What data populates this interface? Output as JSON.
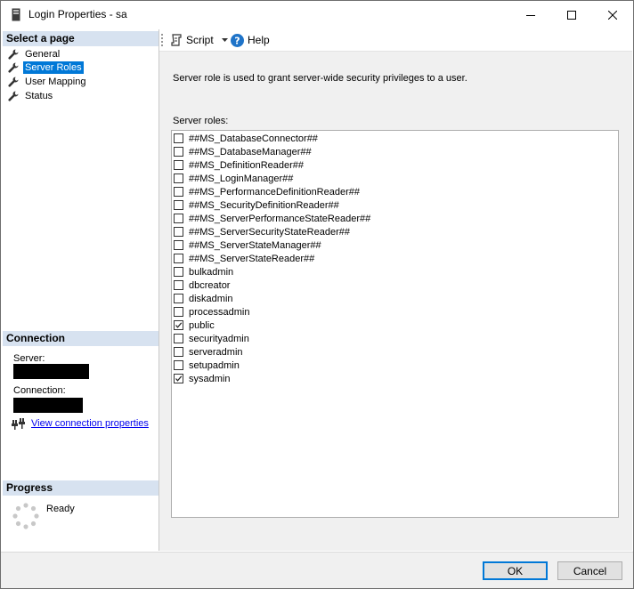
{
  "window": {
    "title": "Login Properties - sa"
  },
  "left": {
    "select_page_header": "Select a page",
    "pages": [
      {
        "label": "General",
        "selected": false
      },
      {
        "label": "Server Roles",
        "selected": true
      },
      {
        "label": "User Mapping",
        "selected": false
      },
      {
        "label": "Status",
        "selected": false
      }
    ],
    "connection_header": "Connection",
    "server_label": "Server:",
    "connection_label": "Connection:",
    "view_connection_properties": "View connection properties",
    "progress_header": "Progress",
    "progress_status": "Ready"
  },
  "toolbar": {
    "script_label": "Script",
    "help_label": "Help"
  },
  "main": {
    "description": "Server role is used to grant server-wide security privileges to a user.",
    "roles_label": "Server roles:",
    "roles": [
      {
        "name": "##MS_DatabaseConnector##",
        "checked": false
      },
      {
        "name": "##MS_DatabaseManager##",
        "checked": false
      },
      {
        "name": "##MS_DefinitionReader##",
        "checked": false
      },
      {
        "name": "##MS_LoginManager##",
        "checked": false
      },
      {
        "name": "##MS_PerformanceDefinitionReader##",
        "checked": false
      },
      {
        "name": "##MS_SecurityDefinitionReader##",
        "checked": false
      },
      {
        "name": "##MS_ServerPerformanceStateReader##",
        "checked": false
      },
      {
        "name": "##MS_ServerSecurityStateReader##",
        "checked": false
      },
      {
        "name": "##MS_ServerStateManager##",
        "checked": false
      },
      {
        "name": "##MS_ServerStateReader##",
        "checked": false
      },
      {
        "name": "bulkadmin",
        "checked": false
      },
      {
        "name": "dbcreator",
        "checked": false
      },
      {
        "name": "diskadmin",
        "checked": false
      },
      {
        "name": "processadmin",
        "checked": false
      },
      {
        "name": "public",
        "checked": true
      },
      {
        "name": "securityadmin",
        "checked": false
      },
      {
        "name": "serveradmin",
        "checked": false
      },
      {
        "name": "setupadmin",
        "checked": false
      },
      {
        "name": "sysadmin",
        "checked": true
      }
    ]
  },
  "footer": {
    "ok_label": "OK",
    "cancel_label": "Cancel"
  },
  "colors": {
    "selection": "#0078d7",
    "section_header": "#d7e2f0",
    "link": "#0000ee",
    "help_icon": "#1e73c8"
  }
}
